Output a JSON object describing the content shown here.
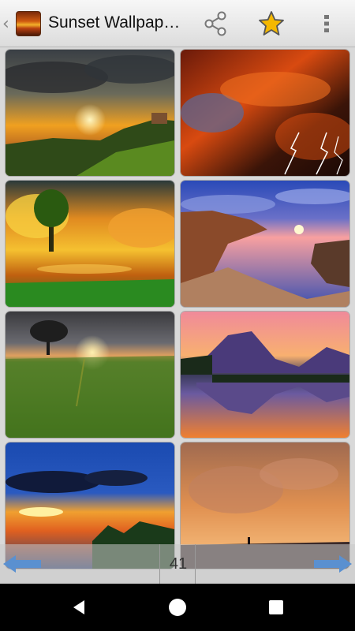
{
  "app": {
    "title": "Sunset Wallpap…",
    "back_icon": "chevron-left-icon",
    "app_icon": "sunset-app-icon"
  },
  "toolbar": {
    "share_icon": "share-icon",
    "favorite_icon": "star-icon",
    "favorite_color": "#f5b800",
    "more_icon": "more-vertical-icon"
  },
  "wallpapers": [
    {
      "name": "sunset-hills-clouds"
    },
    {
      "name": "red-sky-lightning"
    },
    {
      "name": "tree-fiery-clouds-lake"
    },
    {
      "name": "coastal-cliffs-sunset"
    },
    {
      "name": "lone-tree-wheat-field"
    },
    {
      "name": "mountain-lake-reflection"
    },
    {
      "name": "ocean-sunset-palms"
    },
    {
      "name": "hazy-sunset-silhouette"
    }
  ],
  "pager": {
    "page": "41",
    "prev_icon": "arrow-left-icon",
    "next_icon": "arrow-right-icon"
  },
  "system_nav": {
    "back_icon": "nav-back-icon",
    "home_icon": "nav-home-icon",
    "recent_icon": "nav-recent-icon"
  }
}
